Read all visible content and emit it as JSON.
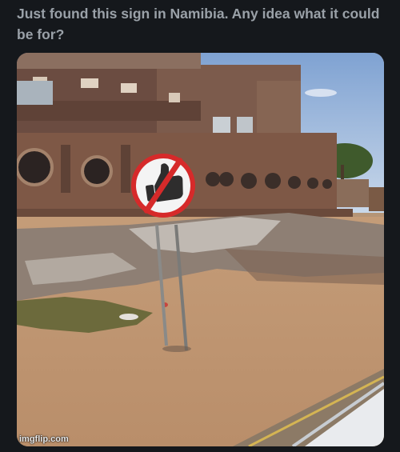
{
  "post": {
    "text": "Just found this sign in Namibia. Any idea what it could be for?"
  },
  "photo": {
    "subject": "prohibition road sign beside dirt road in front of building",
    "sign_symbol": "thumbs-up",
    "sign_ring_color": "#d62a2a"
  },
  "watermark": {
    "text": "imgflip.com"
  }
}
